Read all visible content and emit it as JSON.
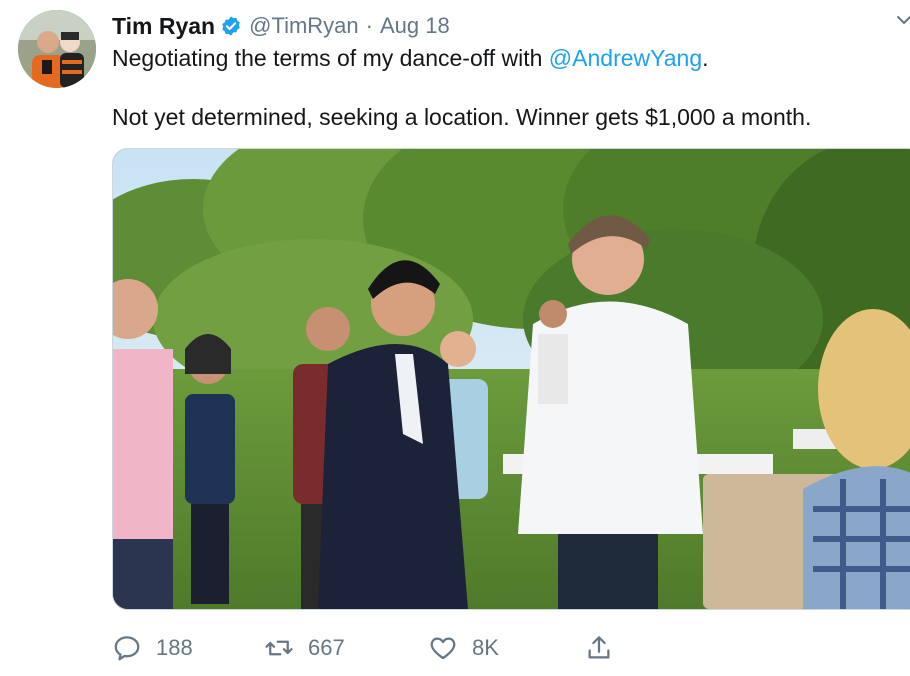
{
  "tweet": {
    "author_name": "Tim Ryan",
    "handle": "@TimRyan",
    "separator": "·",
    "date": "Aug 18",
    "text_before_mention": "Negotiating the terms of my dance-off with ",
    "mention": "@AndrewYang",
    "text_after_mention": ".",
    "text_line2": "Not yet determined, seeking a location. Winner gets $1,000 a month.",
    "verified": true
  },
  "actions": {
    "reply_count": "188",
    "retweet_count": "667",
    "like_count": "8K"
  },
  "colors": {
    "link": "#1da1f2",
    "secondary_text": "#657786",
    "verified_badge": "#1da1f2"
  },
  "icons": {
    "verified": "verified-badge-icon",
    "more": "chevron-down-icon",
    "reply": "reply-icon",
    "retweet": "retweet-icon",
    "like": "heart-icon",
    "share": "share-icon"
  }
}
